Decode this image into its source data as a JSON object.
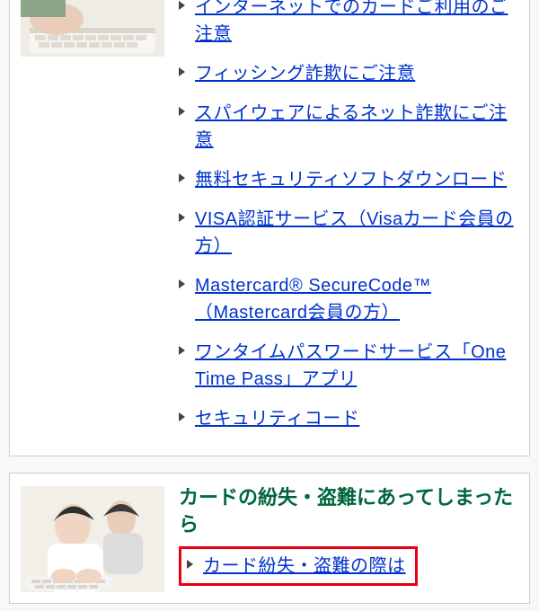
{
  "section1": {
    "links": [
      "インターネットでのカードご利用のご注意",
      "フィッシング詐欺にご注意",
      "スパイウェアによるネット詐欺にご注意",
      "無料セキュリティソフトダウンロード",
      "VISA認証サービス（Visaカード会員の方）",
      "Mastercard® SecureCode™（Mastercard会員の方）",
      "ワンタイムパスワードサービス「One Time Pass」アプリ",
      "セキュリティコード"
    ]
  },
  "section2": {
    "title": "カードの紛失・盗難にあってしまったら",
    "links": [
      "カード紛失・盗難の際は"
    ]
  }
}
